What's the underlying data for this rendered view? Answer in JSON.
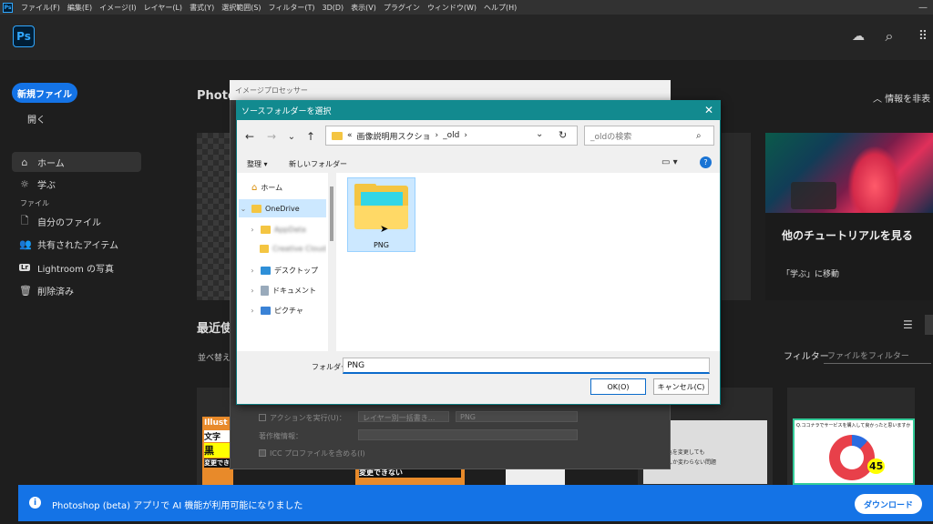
{
  "menubar": {
    "app_badge": "Ps",
    "items": [
      "ファイル(F)",
      "編集(E)",
      "イメージ(I)",
      "レイヤー(L)",
      "書式(Y)",
      "選択範囲(S)",
      "フィルター(T)",
      "3D(D)",
      "表示(V)",
      "プラグイン",
      "ウィンドウ(W)",
      "ヘルプ(H)"
    ],
    "window_controls": [
      "—",
      "☐",
      "✕"
    ]
  },
  "header": {
    "logo": "Ps",
    "cloud_icon": "☁",
    "search_icon": "⌕",
    "apps_icon": "⠿",
    "gift_icon": "🎁"
  },
  "sidebar": {
    "new_file": "新規ファイル",
    "open": "開く",
    "home": "ホーム",
    "learn": "学ぶ",
    "files_label": "ファイル",
    "my_files": "自分のファイル",
    "shared": "共有されたアイテム",
    "lightroom": "Lightroom の写真",
    "deleted": "削除済み",
    "lightroom_badge": "Lr"
  },
  "main": {
    "title": "Photos",
    "info_hide": "情報を非表",
    "tutorial_title": "他のチュートリアルを見る",
    "tutorial_link": "「学ぶ」に移動",
    "recent_title": "最近使",
    "sort_label": "並べ替え",
    "filter_label": "フィルター",
    "filter_placeholder": "ファイルをフィルター",
    "thumb1_text1": "Illust",
    "thumb1_text2": "文字",
    "thumb1_text3": "黒",
    "thumb1_text4": "変更できない",
    "thumb2_text": "変更できない",
    "thumb4_text1": "キストの色を変更しても",
    "thumb4_text2": "グレーにしか変わらない問題",
    "thumb5_title": "Q.ココナラでサービスを購入して良かったと思いますか",
    "thumb5_value": "45"
  },
  "image_processor": {
    "title": "イメージプロセッサー",
    "action_label": "アクションを実行(U)：",
    "action_value1": "レイヤー別一括書き...",
    "action_value2": "PNG",
    "copyright_label": "著作権情報：",
    "icc_label": "ICC プロファイルを含める(I)"
  },
  "dialog": {
    "title": "ソースフォルダーを選択",
    "close": "✕",
    "back": "←",
    "forward": "→",
    "dropdown": "⌄",
    "up": "↑",
    "address_prefix": "«",
    "address_part1": "画像説明用スクショ",
    "address_sep": "›",
    "address_part2": "_old",
    "address_chev": "⌄",
    "refresh": "↻",
    "search_placeholder": "_oldの検索",
    "search_icon": "⌕",
    "organize": "整理 ▾",
    "new_folder": "新しいフォルダー",
    "view_icon": "▭ ▾",
    "help_icon": "?",
    "tree": [
      {
        "label": "ホーム"
      },
      {
        "label": "OneDrive"
      },
      {
        "label": "AppData"
      },
      {
        "label": "Creative Cloud"
      },
      {
        "label": "デスクトップ"
      },
      {
        "label": "ドキュメント"
      },
      {
        "label": "ピクチャ"
      }
    ],
    "folder_name": "PNG",
    "folder_field_label": "フォルダー：",
    "folder_field_value": "PNG",
    "ok": "OK(O)",
    "cancel": "キャンセル(C)"
  },
  "banner": {
    "icon": "i",
    "text": "Photoshop (beta) アプリで AI 機能が利用可能になりました",
    "download": "ダウンロード"
  },
  "colors": {
    "accent": "#1473e6",
    "dialog_title": "#128a8f",
    "selection": "#cce8ff",
    "folder": "#f4c542"
  }
}
